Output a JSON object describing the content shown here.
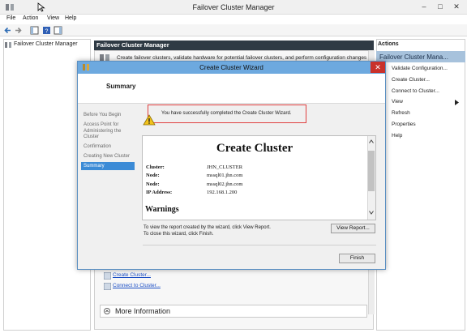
{
  "window": {
    "title": "Failover Cluster Manager",
    "minimize": "–",
    "maximize": "□",
    "close": "✕"
  },
  "menu": [
    "File",
    "Action",
    "View",
    "Help"
  ],
  "tree": {
    "root": "Failover Cluster Manager"
  },
  "main": {
    "header": "Failover Cluster Manager",
    "intro": "Create failover clusters, validate hardware for potential failover clusters, and perform configuration changes to",
    "link_create": "Create Cluster...",
    "link_connect": "Connect to Cluster...",
    "more_info": "More Information"
  },
  "actions": {
    "header": "Actions",
    "sub_header": "Failover Cluster Mana...",
    "items": [
      "Validate Configuration...",
      "Create Cluster...",
      "Connect to Cluster...",
      "View",
      "Refresh",
      "Properties",
      "Help"
    ]
  },
  "wizard": {
    "title": "Create Cluster Wizard",
    "close": "✕",
    "heading": "Summary",
    "steps": [
      "Before You Begin",
      "Access Point for Administering the Cluster",
      "Confirmation",
      "Creating New Cluster",
      "Summary"
    ],
    "success_message": "You have successfully completed the Create Cluster Wizard.",
    "report": {
      "title": "Create Cluster",
      "rows": [
        {
          "key": "Cluster:",
          "value": "JHN_CLUSTER"
        },
        {
          "key": "Node:",
          "value": "mssql01.jhn.com"
        },
        {
          "key": "Node:",
          "value": "mssql02.jhn.com"
        },
        {
          "key": "IP Address:",
          "value": "192.168.1.200"
        }
      ],
      "warnings": "Warnings"
    },
    "hint_line1": "To view the report created by the wizard, click View Report.",
    "hint_line2": "To close this wizard, click Finish.",
    "view_report_button": "View Report...",
    "finish_button": "Finish"
  },
  "colors": {
    "wizard_titlebar": "#6da9df",
    "active_step": "#3c8bd6",
    "close_button": "#c9312a",
    "actions_selected": "#a7c2dc"
  }
}
